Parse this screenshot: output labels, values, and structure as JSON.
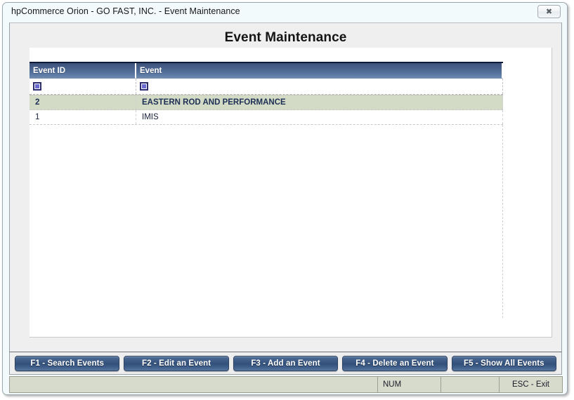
{
  "window": {
    "title": "hpCommerce Orion - GO FAST, INC. - Event Maintenance",
    "close_icon": "close-icon",
    "close_glyph": "✖"
  },
  "page": {
    "heading": "Event Maintenance"
  },
  "grid": {
    "columns": [
      {
        "key": "event_id",
        "label": "Event ID"
      },
      {
        "key": "event",
        "label": "Event"
      }
    ],
    "filter_row": {
      "event_id_icon": "filter-icon",
      "event_icon": "filter-icon"
    },
    "rows": [
      {
        "event_id": "2",
        "event": "EASTERN ROD AND PERFORMANCE",
        "selected": true
      },
      {
        "event_id": "1",
        "event": "IMIS",
        "selected": false
      }
    ]
  },
  "buttons": [
    {
      "label": "F1 - Search Events",
      "name": "search-events-button"
    },
    {
      "label": "F2 - Edit an Event",
      "name": "edit-event-button"
    },
    {
      "label": "F3 - Add an Event",
      "name": "add-event-button"
    },
    {
      "label": "F4 - Delete an Event",
      "name": "delete-event-button"
    },
    {
      "label": "F5 - Show All Events",
      "name": "show-all-events-button"
    }
  ],
  "status_bar": {
    "message": "",
    "num_indicator": "NUM",
    "blank": "",
    "exit_hint": "ESC - Exit"
  },
  "colors": {
    "header_blue": "#3c5179",
    "button_blue": "#3d5a85",
    "selected_row": "#d3dac5",
    "status_bg": "#d6dbcb",
    "title_bar": "#f2fafc"
  }
}
